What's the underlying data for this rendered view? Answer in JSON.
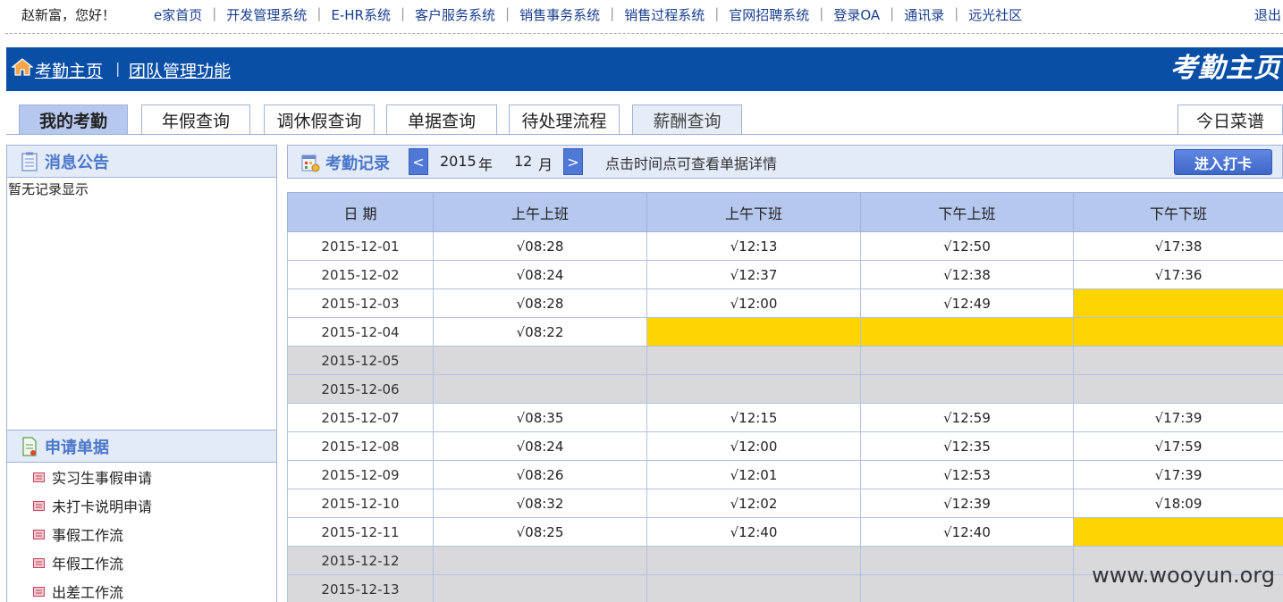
{
  "topbar": {
    "greeting": "赵新富，您好！",
    "links": [
      "e家首页",
      "开发管理系统",
      "E-HR系统",
      "客户服务系统",
      "销售事务系统",
      "销售过程系统",
      "官网招聘系统",
      "登录OA",
      "通讯录",
      "远光社区"
    ],
    "logout": "退出"
  },
  "banner": {
    "home_link": "考勤主页",
    "team_link": "团队管理功能",
    "separator": "|",
    "title": "考勤主页"
  },
  "tabs": {
    "my_attendance": "我的考勤",
    "annual_leave": "年假查询",
    "comp_leave": "调休假查询",
    "documents": "单据查询",
    "pending": "待处理流程",
    "salary": "薪酬查询",
    "menu": "今日菜谱"
  },
  "notice": {
    "title": "消息公告",
    "empty": "暂无记录显示"
  },
  "requests": {
    "title": "申请单据",
    "items": [
      "实习生事假申请",
      "未打卡说明申请",
      "事假工作流",
      "年假工作流",
      "出差工作流"
    ]
  },
  "record": {
    "title": "考勤记录",
    "prev": "<",
    "next": ">",
    "year": "2015",
    "year_unit": "年",
    "month": "12",
    "month_unit": "月",
    "hint": "点击时间点可查看单据详情",
    "punch_button": "进入打卡"
  },
  "table": {
    "headers": [
      "日 期",
      "上午上班",
      "上午下班",
      "下午上班",
      "下午下班"
    ],
    "rows": [
      {
        "date": "2015-12-01",
        "c1": "√08:28",
        "c2": "√12:13",
        "c3": "√12:50",
        "c4": "√17:38",
        "status": [
          "ok",
          "ok",
          "ok",
          "ok"
        ]
      },
      {
        "date": "2015-12-02",
        "c1": "√08:24",
        "c2": "√12:37",
        "c3": "√12:38",
        "c4": "√17:36",
        "status": [
          "ok",
          "ok",
          "ok",
          "ok"
        ]
      },
      {
        "date": "2015-12-03",
        "c1": "√08:28",
        "c2": "√12:00",
        "c3": "√12:49",
        "c4": "",
        "status": [
          "ok",
          "ok",
          "ok",
          "miss"
        ]
      },
      {
        "date": "2015-12-04",
        "c1": "√08:22",
        "c2": "",
        "c3": "",
        "c4": "",
        "status": [
          "ok",
          "miss",
          "miss",
          "miss"
        ]
      },
      {
        "date": "2015-12-05",
        "c1": "",
        "c2": "",
        "c3": "",
        "c4": "",
        "status": [
          "weekend",
          "weekend",
          "weekend",
          "weekend"
        ]
      },
      {
        "date": "2015-12-06",
        "c1": "",
        "c2": "",
        "c3": "",
        "c4": "",
        "status": [
          "weekend",
          "weekend",
          "weekend",
          "weekend"
        ]
      },
      {
        "date": "2015-12-07",
        "c1": "√08:35",
        "c2": "√12:15",
        "c3": "√12:59",
        "c4": "√17:39",
        "status": [
          "ok",
          "ok",
          "ok",
          "ok"
        ]
      },
      {
        "date": "2015-12-08",
        "c1": "√08:24",
        "c2": "√12:00",
        "c3": "√12:35",
        "c4": "√17:59",
        "status": [
          "ok",
          "ok",
          "ok",
          "ok"
        ]
      },
      {
        "date": "2015-12-09",
        "c1": "√08:26",
        "c2": "√12:01",
        "c3": "√12:53",
        "c4": "√17:39",
        "status": [
          "ok",
          "ok",
          "ok",
          "ok"
        ]
      },
      {
        "date": "2015-12-10",
        "c1": "√08:32",
        "c2": "√12:02",
        "c3": "√12:39",
        "c4": "√18:09",
        "status": [
          "ok",
          "ok",
          "ok",
          "ok"
        ]
      },
      {
        "date": "2015-12-11",
        "c1": "√08:25",
        "c2": "√12:40",
        "c3": "√12:40",
        "c4": "",
        "status": [
          "ok",
          "ok",
          "ok",
          "miss"
        ]
      },
      {
        "date": "2015-12-12",
        "c1": "",
        "c2": "",
        "c3": "",
        "c4": "",
        "status": [
          "weekend",
          "weekend",
          "weekend",
          "weekend"
        ]
      },
      {
        "date": "2015-12-13",
        "c1": "",
        "c2": "",
        "c3": "",
        "c4": "",
        "status": [
          "weekend",
          "weekend",
          "weekend",
          "weekend"
        ]
      }
    ]
  },
  "colors": {
    "banner": "#0a4fa6",
    "header_cell": "#b7c8ef",
    "missing": "#ffd500",
    "weekend": "#d9d9dc",
    "link": "#1a3f8f"
  },
  "watermark": "www.wooyun.org"
}
